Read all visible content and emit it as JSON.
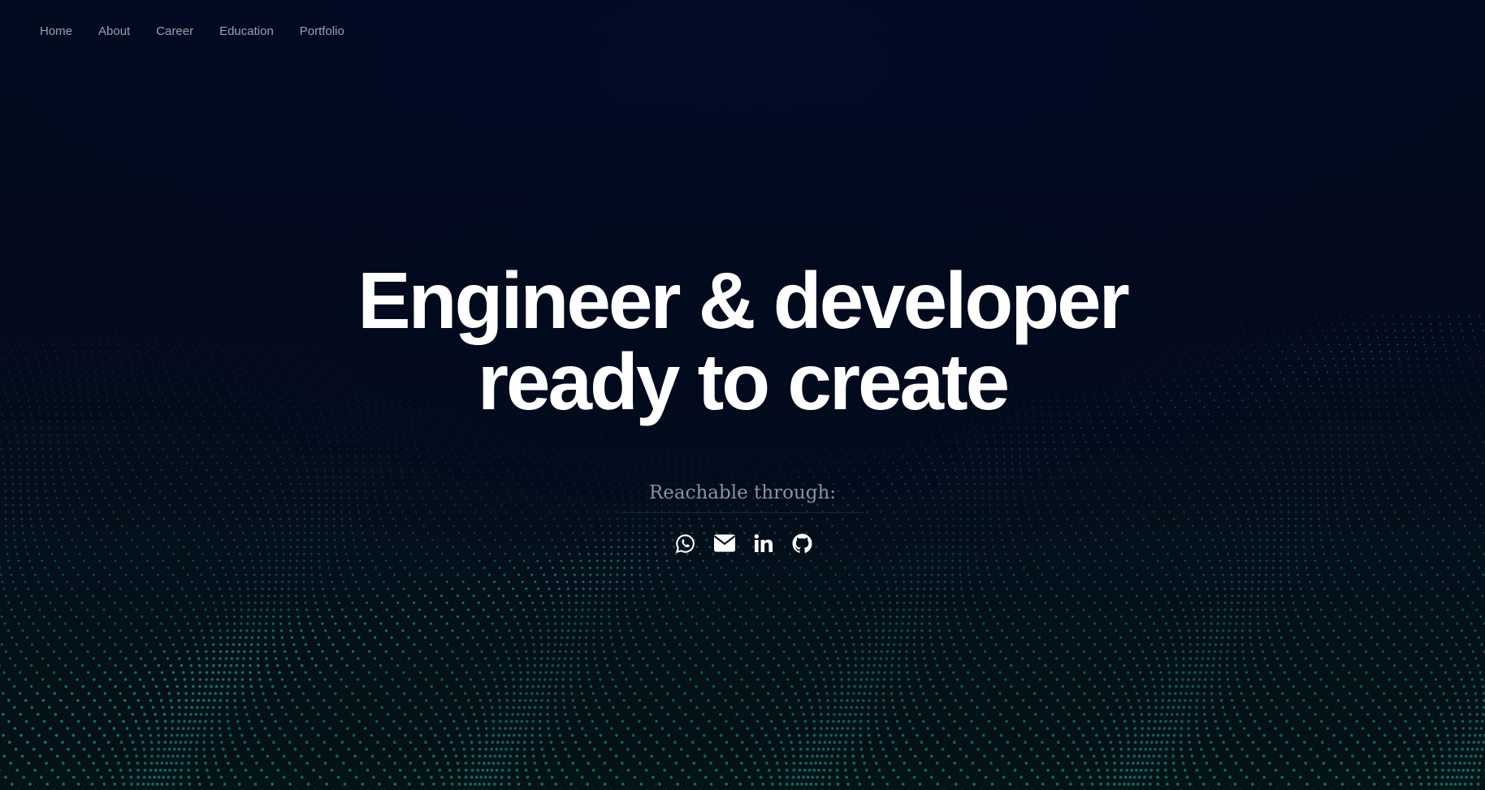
{
  "nav": {
    "items": [
      {
        "label": "Home"
      },
      {
        "label": "About"
      },
      {
        "label": "Career"
      },
      {
        "label": "Education"
      },
      {
        "label": "Portfolio"
      }
    ]
  },
  "hero": {
    "line1": "Engineer & developer",
    "line2": "ready to create"
  },
  "contact": {
    "label": "Reachable through:",
    "links": [
      {
        "icon": "whatsapp-icon"
      },
      {
        "icon": "envelope-icon"
      },
      {
        "icon": "linkedin-icon"
      },
      {
        "icon": "github-icon"
      }
    ]
  },
  "colors": {
    "background": "#020a1d",
    "dots": "#1f8f88",
    "nav_text": "#9aa1ac",
    "heading": "#ffffff",
    "subtle_text": "#8d929b"
  }
}
